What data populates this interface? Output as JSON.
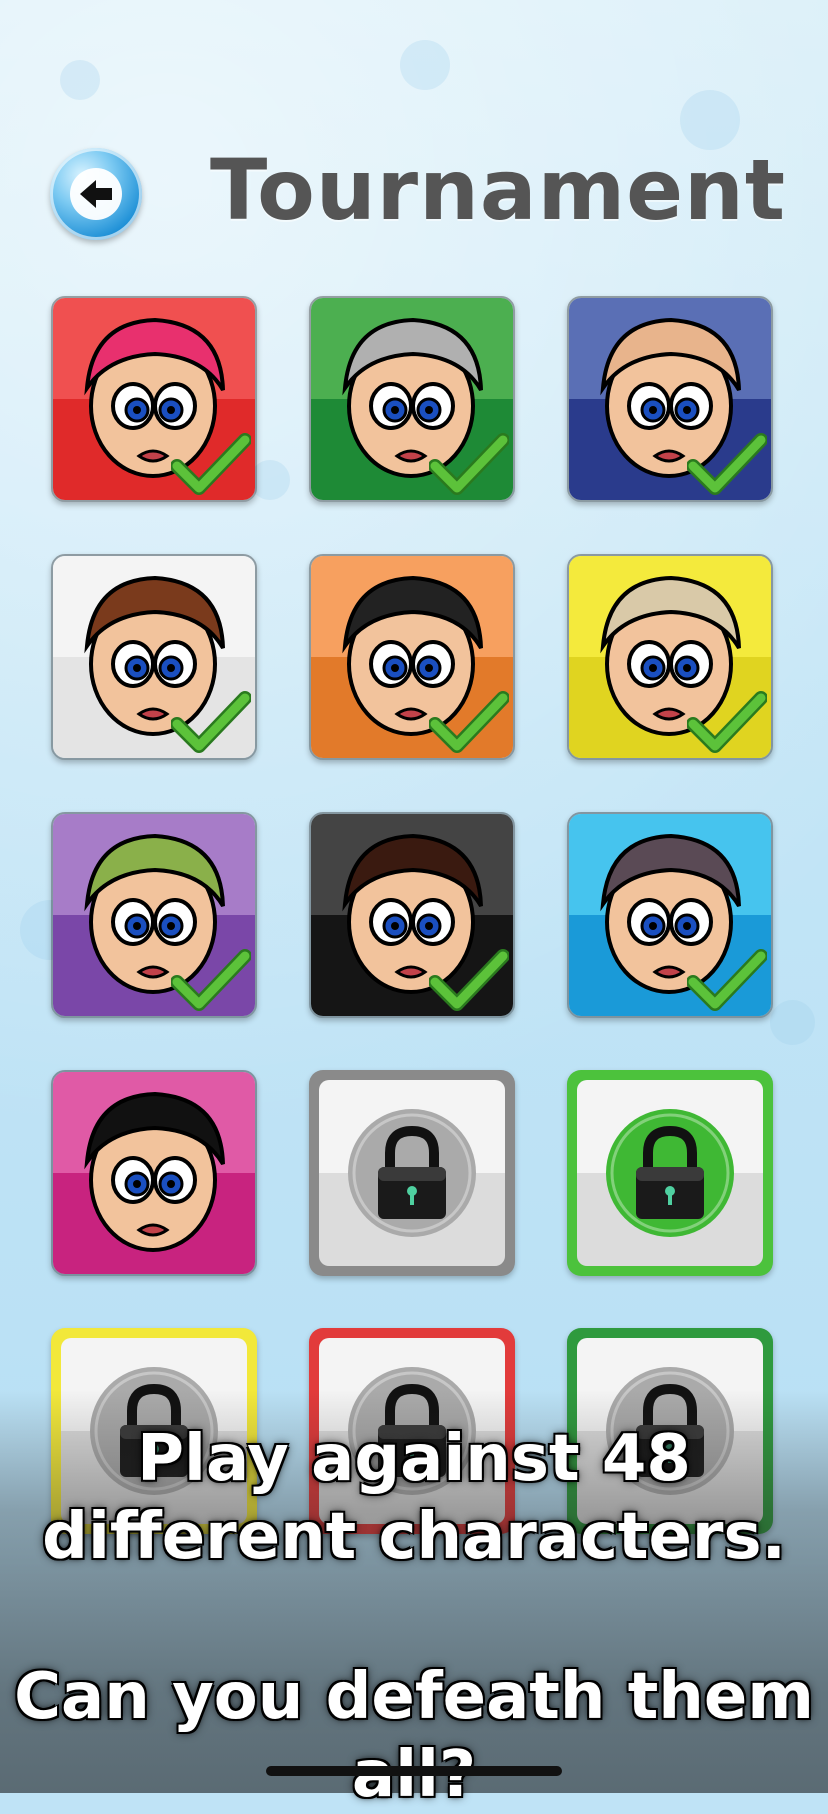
{
  "header": {
    "title": "Tournament",
    "back_icon": "back-arrow-icon"
  },
  "characters": [
    {
      "name": "character-1",
      "status": "defeated",
      "top": "#f05050",
      "bottom": "#e02a2a"
    },
    {
      "name": "character-2",
      "status": "defeated",
      "top": "#4caf50",
      "bottom": "#1e8a36"
    },
    {
      "name": "character-3",
      "status": "defeated",
      "top": "#5a6fb5",
      "bottom": "#2a3b8c"
    },
    {
      "name": "character-4",
      "status": "defeated",
      "top": "#f4f4f4",
      "bottom": "#e4e4e4"
    },
    {
      "name": "character-5",
      "status": "defeated",
      "top": "#f7a05f",
      "bottom": "#e27a2a"
    },
    {
      "name": "character-6",
      "status": "defeated",
      "top": "#f4ea3c",
      "bottom": "#e0d420"
    },
    {
      "name": "character-7",
      "status": "defeated",
      "top": "#a77cc8",
      "bottom": "#7a47a8"
    },
    {
      "name": "character-8",
      "status": "defeated",
      "top": "#444444",
      "bottom": "#151515"
    },
    {
      "name": "character-9",
      "status": "defeated",
      "top": "#46c4ee",
      "bottom": "#1a9ad8"
    },
    {
      "name": "character-10",
      "status": "unlocked",
      "top": "#e05aa6",
      "bottom": "#c8237f"
    },
    {
      "name": "locked-11",
      "status": "locked",
      "frame": "#8a8a8a",
      "circle": "#aaaaaa"
    },
    {
      "name": "locked-12",
      "status": "locked",
      "frame": "#4cc23c",
      "circle": "#3fb834"
    },
    {
      "name": "locked-13",
      "status": "locked",
      "frame": "#f2e83a",
      "circle": "#aaaaaa"
    },
    {
      "name": "locked-14",
      "status": "locked",
      "frame": "#e23b3b",
      "circle": "#aaaaaa"
    },
    {
      "name": "locked-15",
      "status": "locked",
      "frame": "#2f9a3e",
      "circle": "#aaaaaa"
    }
  ],
  "promo": {
    "line1": "Play against 48",
    "line2": "different characters.",
    "line3": "Can you defeath them all?"
  },
  "colors": {
    "check": "#5cc23a",
    "title": "#555555",
    "back_button": "#1d8fd6"
  }
}
